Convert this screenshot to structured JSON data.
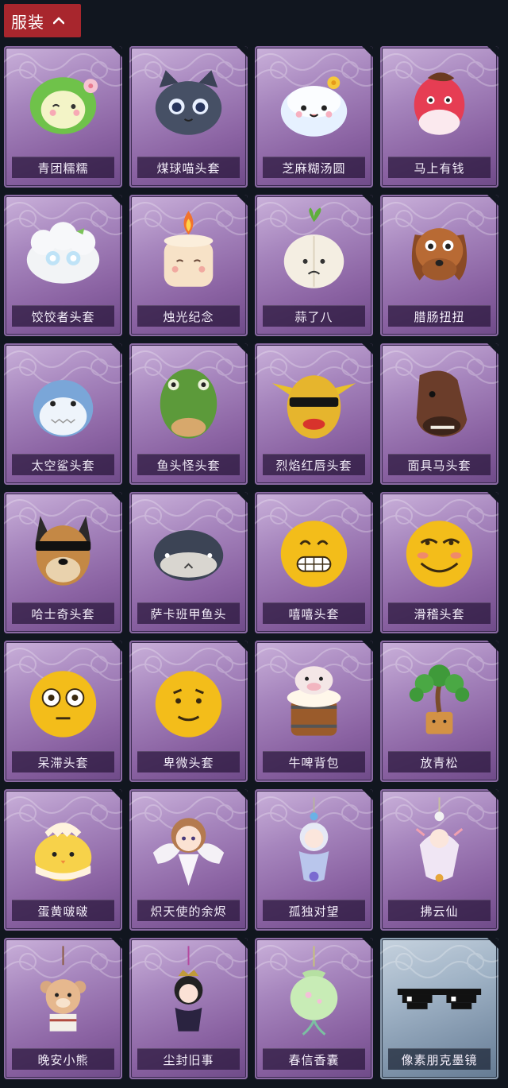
{
  "header": {
    "label": "服装",
    "icon": "chevron-up-icon"
  },
  "items": [
    {
      "name": "青团糯糯",
      "icon": "green-dumpling-icon"
    },
    {
      "name": "煤球喵头套",
      "icon": "black-cat-head-icon"
    },
    {
      "name": "芝麻糊汤圆",
      "icon": "rice-ball-icon"
    },
    {
      "name": "马上有钱",
      "icon": "red-horse-icon"
    },
    {
      "name": "饺饺者头套",
      "icon": "dumpling-cloud-icon"
    },
    {
      "name": "烛光纪念",
      "icon": "candle-icon"
    },
    {
      "name": "蒜了八",
      "icon": "garlic-icon"
    },
    {
      "name": "腊肠扭扭",
      "icon": "dachshund-icon"
    },
    {
      "name": "太空鲨头套",
      "icon": "shark-icon"
    },
    {
      "name": "鱼头怪头套",
      "icon": "fish-head-icon"
    },
    {
      "name": "烈焰红唇头套",
      "icon": "yellow-mask-sunglasses-icon"
    },
    {
      "name": "面具马头套",
      "icon": "horse-mask-icon"
    },
    {
      "name": "哈士奇头套",
      "icon": "husky-sunglasses-icon"
    },
    {
      "name": "萨卡班甲鱼头",
      "icon": "sacabambaspis-icon"
    },
    {
      "name": "嘻嘻头套",
      "icon": "grin-emoji-icon"
    },
    {
      "name": "滑稽头套",
      "icon": "smirk-emoji-icon"
    },
    {
      "name": "呆滞头套",
      "icon": "dazed-emoji-icon"
    },
    {
      "name": "卑微头套",
      "icon": "humble-emoji-icon"
    },
    {
      "name": "牛啤背包",
      "icon": "cow-beer-backpack-icon"
    },
    {
      "name": "放青松",
      "icon": "bonsai-pine-icon"
    },
    {
      "name": "蛋黄啵啵",
      "icon": "chick-egg-icon"
    },
    {
      "name": "炽天使的余烬",
      "icon": "angel-figure-icon"
    },
    {
      "name": "孤独对望",
      "icon": "charm-figure-icon"
    },
    {
      "name": "拂云仙",
      "icon": "fairy-charm-icon"
    },
    {
      "name": "晚安小熊",
      "icon": "bear-charm-icon"
    },
    {
      "name": "尘封旧事",
      "icon": "prince-charm-icon"
    },
    {
      "name": "春信香囊",
      "icon": "sachet-icon"
    },
    {
      "name": "像素朋克墨镜",
      "icon": "pixel-sunglasses-icon"
    }
  ]
}
